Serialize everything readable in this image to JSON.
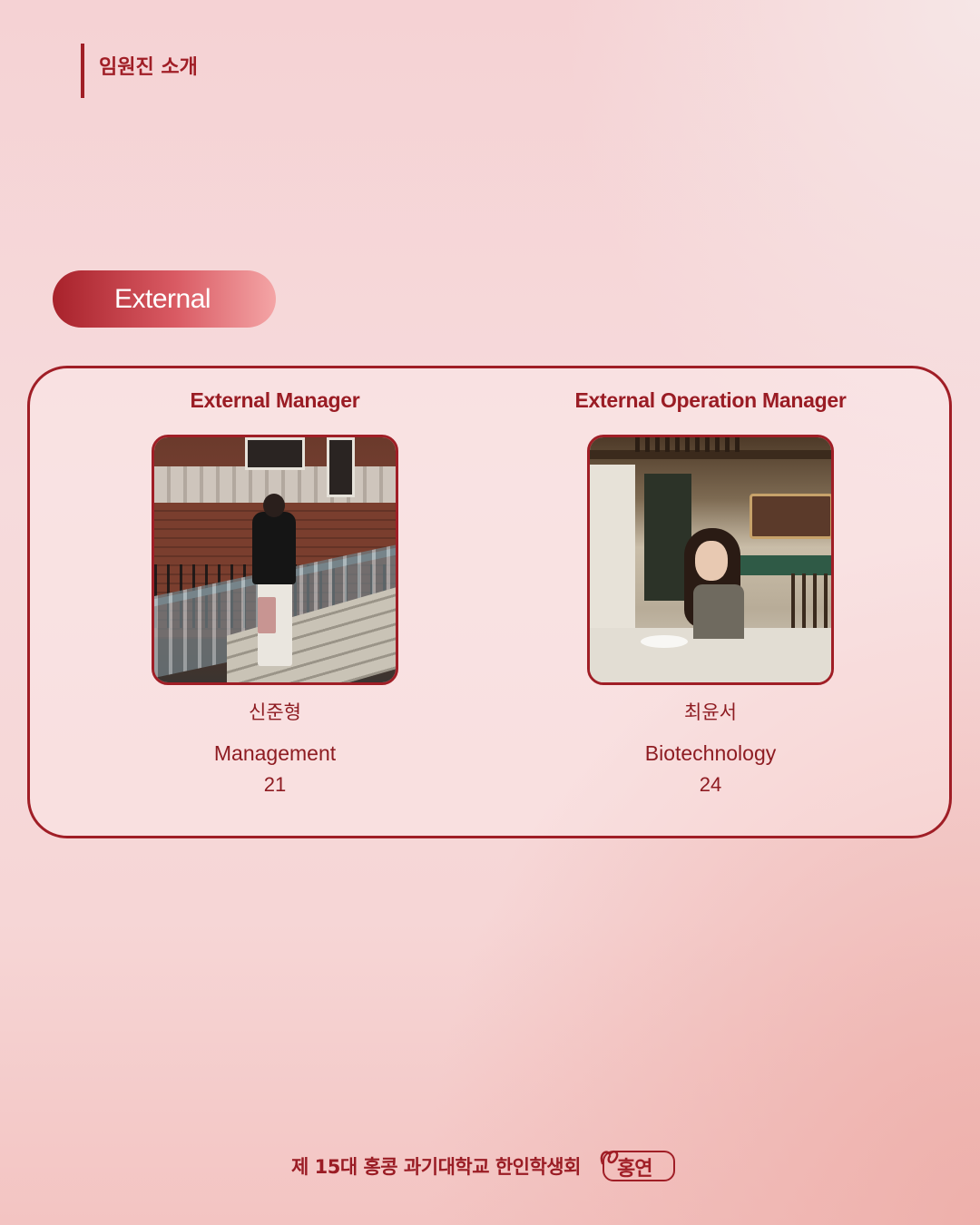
{
  "header": {
    "title": "임원진 소개"
  },
  "section": {
    "label": "External"
  },
  "members": [
    {
      "role": "External Manager",
      "name": "신준형",
      "major": "Management",
      "year": "21"
    },
    {
      "role": "External Operation Manager",
      "name": "최윤서",
      "major": "Biotechnology",
      "year": "24"
    }
  ],
  "footer": {
    "text": "제 15대 홍콩 과기대학교 한인학생회",
    "logo_text": "홍연"
  },
  "colors": {
    "accent": "#a01e26",
    "background": "#f6d6d6"
  }
}
